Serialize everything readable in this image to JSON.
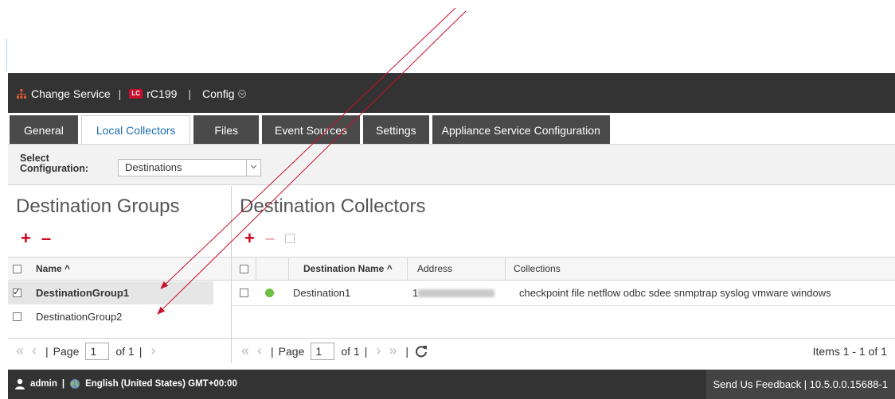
{
  "header": {
    "change_service": "Change Service",
    "sep": "|",
    "lc_badge": "LC",
    "service_name": "rC199",
    "config": "Config"
  },
  "tabs": [
    "General",
    "Local Collectors",
    "Files",
    "Event Sources",
    "Settings",
    "Appliance Service Configuration"
  ],
  "config_bar": {
    "label_line1": "Select",
    "label_line2": "Configuration:",
    "selected": "Destinations"
  },
  "left_panel": {
    "title": "Destination Groups",
    "col_name": "Name ^",
    "rows": [
      "DestinationGroup1",
      "DestinationGroup2"
    ],
    "pager": {
      "page_label": "Page",
      "page_value": "1",
      "of_label": "of 1"
    }
  },
  "right_panel": {
    "title": "Destination Collectors",
    "columns": {
      "name": "Destination Name ^",
      "address": "Address",
      "collections": "Collections"
    },
    "rows": [
      {
        "name": "Destination1",
        "address_prefix": "1",
        "collections": "checkpoint file netflow odbc sdee snmptrap syslog vmware windows",
        "status_color": "#6ec043"
      }
    ],
    "pager": {
      "page_label": "Page",
      "page_value": "1",
      "of_label": "of 1",
      "items": "Items 1 - 1 of 1"
    }
  },
  "footer": {
    "user": "admin",
    "locale": "English (United States) GMT+00:00",
    "feedback": "Send Us Feedback | 10.5.0.0.15688-1"
  },
  "colors": {
    "accent": "#d0021b",
    "header_bg": "#333333",
    "active_tab_text": "#1a6fb0",
    "annotation": "#c8102e"
  }
}
